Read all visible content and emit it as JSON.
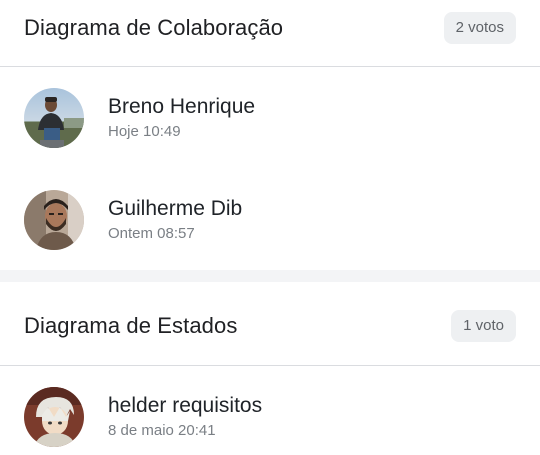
{
  "sections": [
    {
      "title": "Diagrama de Colaboração",
      "votes_label": "2 votos",
      "voters": [
        {
          "name": "Breno Henrique",
          "time": "Hoje 10:49",
          "avatar": "avatar-photo-outdoor"
        },
        {
          "name": "Guilherme Dib",
          "time": "Ontem 08:57",
          "avatar": "avatar-photo-bearded"
        }
      ]
    },
    {
      "title": "Diagrama de Estados",
      "votes_label": "1 voto",
      "voters": [
        {
          "name": "helder requisitos",
          "time": "8 de maio 20:41",
          "avatar": "avatar-anime-character"
        }
      ]
    }
  ],
  "colors": {
    "pill_background": "#eef0f2",
    "divider": "#dadce0",
    "section_gap": "#f3f4f6",
    "secondary_text": "#7a7f85"
  }
}
